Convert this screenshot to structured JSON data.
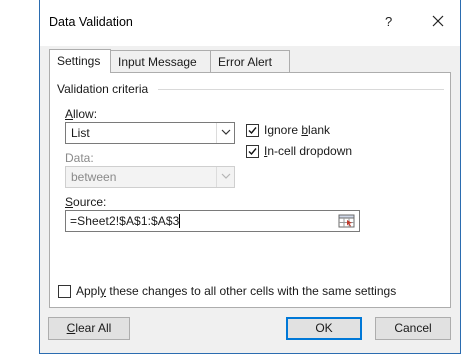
{
  "dialog": {
    "title": "Data Validation",
    "help_label": "?",
    "close_icon": "close-icon"
  },
  "tabs": [
    {
      "label": "Settings",
      "active": true
    },
    {
      "label": "Input Message",
      "active": false
    },
    {
      "label": "Error Alert",
      "active": false
    }
  ],
  "criteria": {
    "group_label": "Validation criteria",
    "allow": {
      "label_underlined": "A",
      "label_rest": "llow:",
      "value": "List"
    },
    "data": {
      "label": "Data:",
      "value": "between",
      "disabled": true
    },
    "ignore_blank": {
      "label_pre": "Ignore ",
      "label_underlined": "b",
      "label_post": "lank",
      "checked": true
    },
    "incell_dropdown": {
      "label_underlined": "I",
      "label_rest": "n-cell dropdown",
      "checked": true
    },
    "source": {
      "label_underlined": "S",
      "label_rest": "ource:",
      "value": "=Sheet2!$A$1:$A$3",
      "range_icon": "range-selector-icon"
    }
  },
  "apply_all": {
    "label_pre": "Appl",
    "label_underlined": "y",
    "label_post": " these changes to all other cells with the same settings",
    "checked": false
  },
  "buttons": {
    "clear_all_underlined": "C",
    "clear_all_rest": "lear All",
    "ok": "OK",
    "cancel": "Cancel"
  },
  "colors": {
    "accent": "#0078d7",
    "window_border": "#2b6cb0",
    "dialog_bg": "#f0f0f0",
    "button_bg": "#e1e1e1"
  }
}
